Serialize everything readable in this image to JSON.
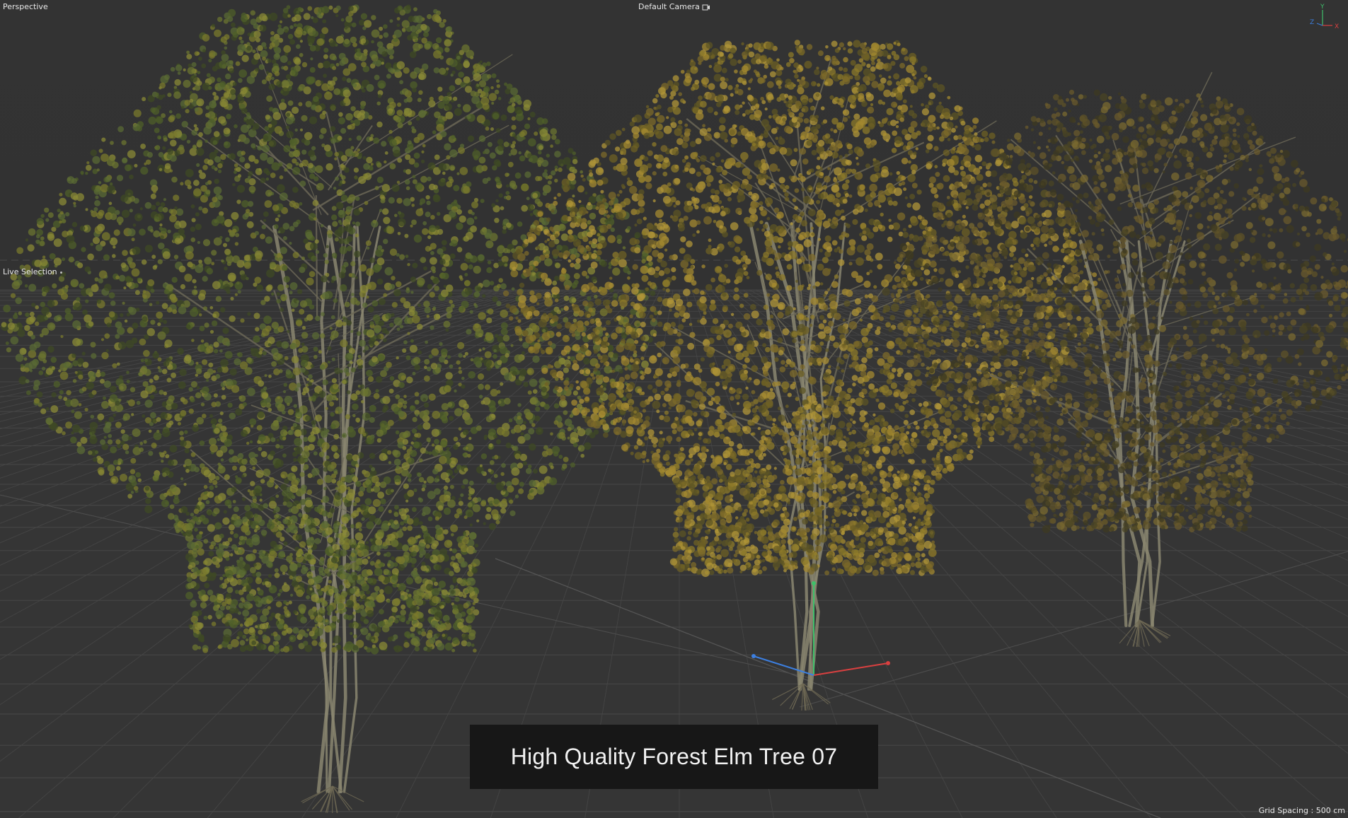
{
  "viewport": {
    "view_mode": "Perspective",
    "camera_name": "Default Camera",
    "active_tool": "Live Selection",
    "grid_spacing": "Grid Spacing : 500 cm"
  },
  "axis_gizmo": {
    "y_label": "Y",
    "z_label": "Z",
    "x_label": "X"
  },
  "caption": {
    "title": "High Quality Forest Elm Tree 07"
  },
  "scene_objects": [
    {
      "name": "elm-tree-green",
      "foliage_color": "#5c6b2e"
    },
    {
      "name": "elm-tree-yellow",
      "foliage_color": "#8c7a2a"
    },
    {
      "name": "elm-tree-sparse",
      "foliage_color": "#5e5228"
    }
  ],
  "colors": {
    "background": "#333333",
    "axis_x": "#d94040",
    "axis_y": "#3fbf6a",
    "axis_z": "#3c7fe0",
    "caption_bg": "#171717"
  }
}
